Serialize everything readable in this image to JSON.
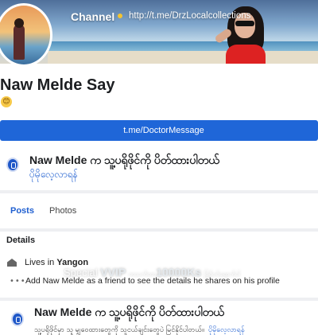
{
  "header": {
    "channel_label": "Channel",
    "channel_url": "http://t.me/DrzLocalcollections"
  },
  "profile": {
    "name": "Naw Melde Say",
    "emoji": "😊"
  },
  "message_button": {
    "label": "t.me/DoctorMessage"
  },
  "lock_card": {
    "title": "Naw Melde က သူ့ပရိုဖိုင်ကို ပိတ်ထားပါတယ်",
    "link": "ပိုမိုလေ့လာရန်"
  },
  "tabs": {
    "posts": "Posts",
    "photos": "Photos"
  },
  "details": {
    "heading": "Details",
    "lives_in_prefix": "Lives in",
    "lives_in_city": "Yangon",
    "add_friend_text": "Add Naw Melde as a friend to see the details he shares on his profile"
  },
  "overlay": {
    "special": "Special",
    "vvip": "VVIP",
    "count_mm": "တသက်တာ",
    "count": "10000Ks",
    "suffix": "ဖြင့်ဝင်ရောက်ပါ"
  },
  "bottom_card": {
    "title": "Naw Melde က သူ့ပရိုဖိုင်ကို ပိတ်ထားပါတယ်",
    "subtitle": "သူ့ပရိုဖိုင်မှာ သူ မျှဝေထားတွေကို သူငယ်ချင်းတွေပဲ မြင်နိုင်ပါတယ်။",
    "link": "ပိုမိုလေ့လာရန်"
  },
  "colors": {
    "accent_blue": "#1f66d8",
    "link_blue": "#1f5fd0",
    "page_bg": "#eeeff2"
  }
}
